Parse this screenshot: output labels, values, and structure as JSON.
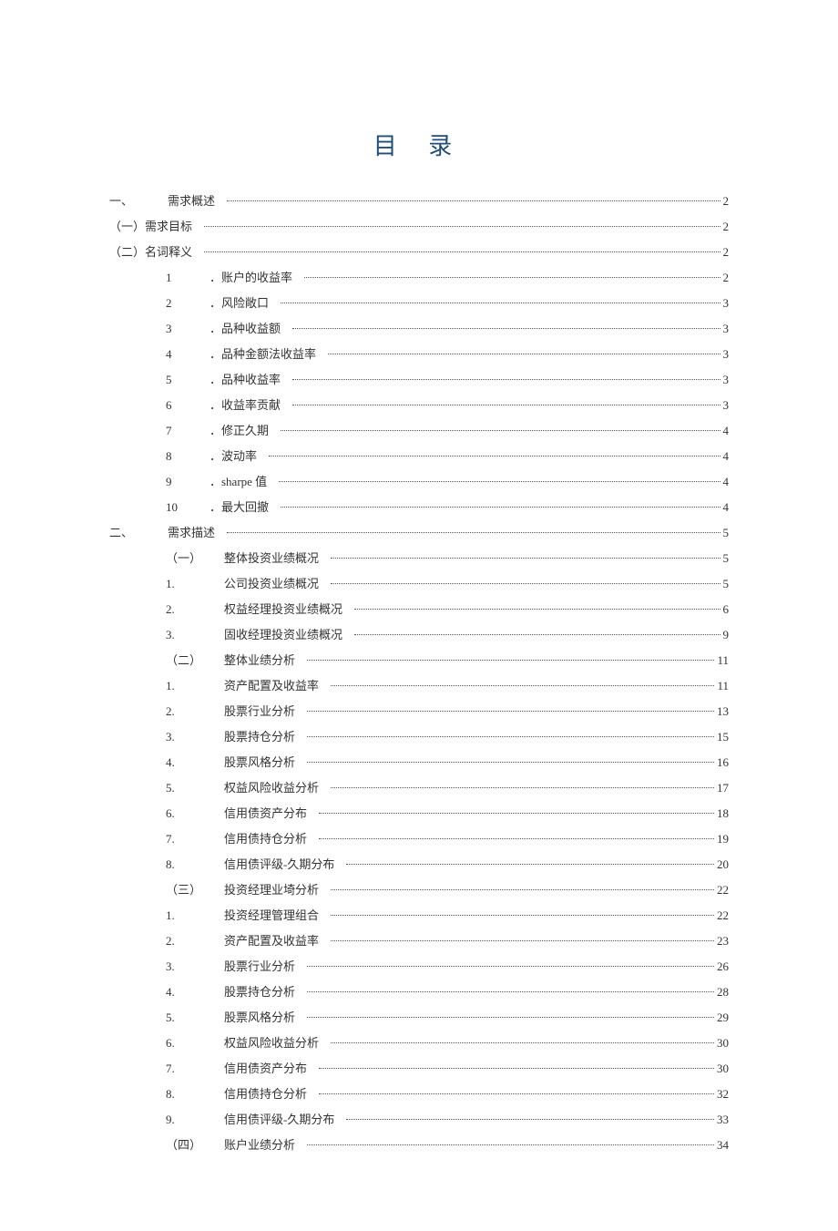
{
  "title": "目 录",
  "toc": [
    {
      "lvl": 0,
      "num": "一、",
      "label": "需求概述",
      "pg": "2",
      "wide": true
    },
    {
      "lvl": 1,
      "num": "（一）",
      "label": "需求目标",
      "pg": "2",
      "join": true
    },
    {
      "lvl": 1,
      "num": "（二）",
      "label": "名词释义",
      "pg": "2",
      "join": true
    },
    {
      "lvl": 2,
      "num": "1",
      "label": "．账户的收益率",
      "pg": "2"
    },
    {
      "lvl": 2,
      "num": "2",
      "label": "．风险敞口",
      "pg": "3"
    },
    {
      "lvl": 2,
      "num": "3",
      "label": "．品种收益额",
      "pg": "3"
    },
    {
      "lvl": 2,
      "num": "4",
      "label": "．品种金额法收益率",
      "pg": "3"
    },
    {
      "lvl": 2,
      "num": "5",
      "label": "．品种收益率",
      "pg": "3"
    },
    {
      "lvl": 2,
      "num": "6",
      "label": "．收益率贡献",
      "pg": "3"
    },
    {
      "lvl": 2,
      "num": "7",
      "label": "．修正久期",
      "pg": "4"
    },
    {
      "lvl": 2,
      "num": "8",
      "label": "．波动率",
      "pg": "4"
    },
    {
      "lvl": 2,
      "num": "9",
      "label": "．sharpe 值",
      "pg": "4"
    },
    {
      "lvl": 2,
      "num": "10",
      "label": "．最大回撤",
      "pg": "4"
    },
    {
      "lvl": 0,
      "num": "二、",
      "label": "需求描述",
      "pg": "5",
      "wide": true
    },
    {
      "lvl": 3,
      "num": "（一）",
      "label": "整体投资业绩概况",
      "pg": "5",
      "wide": true
    },
    {
      "lvl": 3,
      "num": "1.",
      "label": "公司投资业绩概况",
      "pg": "5",
      "wide": true
    },
    {
      "lvl": 3,
      "num": "2.",
      "label": "权益经理投资业绩概况",
      "pg": "6",
      "wide": true
    },
    {
      "lvl": 3,
      "num": "3.",
      "label": "固收经理投资业绩概况",
      "pg": "9",
      "wide": true
    },
    {
      "lvl": 3,
      "num": "（二）",
      "label": "整体业绩分析",
      "pg": "11",
      "wide": true
    },
    {
      "lvl": 3,
      "num": "1.",
      "label": "资产配置及收益率",
      "pg": "11",
      "wide": true
    },
    {
      "lvl": 3,
      "num": "2.",
      "label": "股票行业分析",
      "pg": "13",
      "wide": true
    },
    {
      "lvl": 3,
      "num": "3.",
      "label": "股票持仓分析",
      "pg": "15",
      "wide": true
    },
    {
      "lvl": 3,
      "num": "4.",
      "label": "股票风格分析",
      "pg": "16",
      "wide": true
    },
    {
      "lvl": 3,
      "num": "5.",
      "label": "权益风险收益分析",
      "pg": "17",
      "wide": true
    },
    {
      "lvl": 3,
      "num": "6.",
      "label": "信用债资产分布",
      "pg": "18",
      "wide": true
    },
    {
      "lvl": 3,
      "num": "7.",
      "label": "信用债持仓分析",
      "pg": "19",
      "wide": true
    },
    {
      "lvl": 3,
      "num": "8.",
      "label": "信用债评级-久期分布",
      "pg": "20",
      "wide": true
    },
    {
      "lvl": 3,
      "num": "（三）",
      "label": "投资经理业埼分析",
      "pg": "22",
      "wide": true
    },
    {
      "lvl": 3,
      "num": "1.",
      "label": "投资经理管理组合",
      "pg": "22",
      "wide": true
    },
    {
      "lvl": 3,
      "num": "2.",
      "label": "资产配置及收益率",
      "pg": "23",
      "wide": true
    },
    {
      "lvl": 3,
      "num": "3.",
      "label": "股票行业分析",
      "pg": "26",
      "wide": true
    },
    {
      "lvl": 3,
      "num": "4.",
      "label": "股票持仓分析",
      "pg": "28",
      "wide": true
    },
    {
      "lvl": 3,
      "num": "5.",
      "label": "股票风格分析",
      "pg": "29",
      "wide": true
    },
    {
      "lvl": 3,
      "num": "6.",
      "label": "权益风险收益分析",
      "pg": "30",
      "wide": true
    },
    {
      "lvl": 3,
      "num": "7.",
      "label": "信用债资产分布",
      "pg": "30",
      "wide": true
    },
    {
      "lvl": 3,
      "num": "8.",
      "label": "信用债持仓分析",
      "pg": "32",
      "wide": true
    },
    {
      "lvl": 3,
      "num": "9.",
      "label": "信用债评级-久期分布",
      "pg": "33",
      "wide": true
    },
    {
      "lvl": 3,
      "num": "（四）",
      "label": "账户业绩分析",
      "pg": "34",
      "wide": true
    }
  ]
}
